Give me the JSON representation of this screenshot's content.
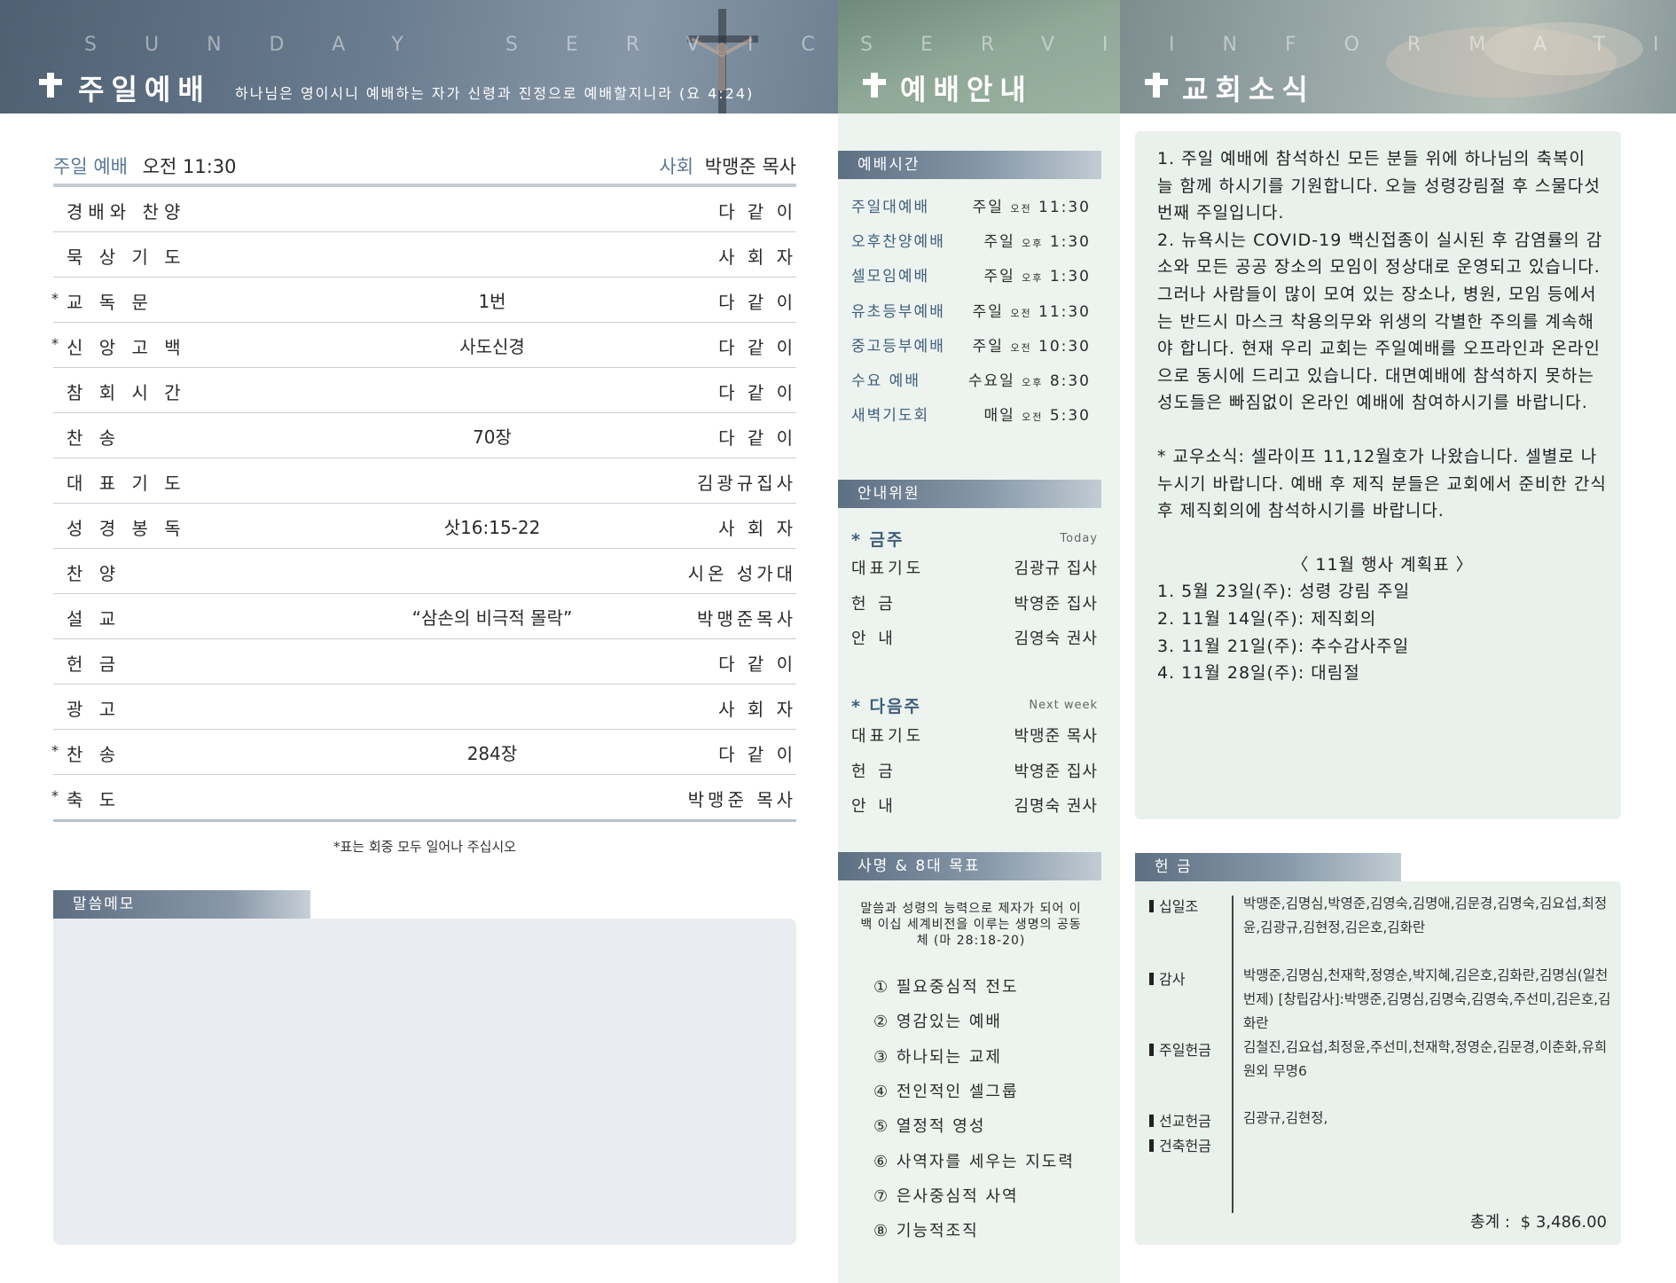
{
  "header": {
    "left_spaced": "SUNDAY SERVICE",
    "left_title": "주일예배",
    "left_verse": "하나님은 영이시니 예배하는 자가 신령과 진정으로 예배할지니라 (요 4:24)",
    "mid_spaced": "SERVICE",
    "mid_title": "예배안내",
    "right_spaced": "INFORMATION",
    "right_title": "교회소식"
  },
  "service": {
    "label": "주일 예배",
    "time": "오전 11:30",
    "leader_label": "사회",
    "leader": "박맹준 목사",
    "rows": [
      {
        "star": "",
        "item": "경배와 찬양",
        "middle": "",
        "who": "다 같 이"
      },
      {
        "star": "",
        "item": "묵 상 기 도",
        "middle": "",
        "who": "사 회 자"
      },
      {
        "star": "*",
        "item": "교   독   문",
        "middle": "1번",
        "who": "다 같 이"
      },
      {
        "star": "*",
        "item": "신 앙 고 백",
        "middle": "사도신경",
        "who": "다 같 이"
      },
      {
        "star": "",
        "item": "참 회 시 간",
        "middle": "",
        "who": "다 같 이"
      },
      {
        "star": "",
        "item": "찬         송",
        "middle": "70장",
        "who": "다 같 이"
      },
      {
        "star": "",
        "item": "대 표 기 도",
        "middle": "",
        "who": "김광규집사"
      },
      {
        "star": "",
        "item": "성 경 봉 독",
        "middle": "삿16:15-22",
        "who": "사 회 자"
      },
      {
        "star": "",
        "item": "찬         양",
        "middle": "",
        "who": "시온 성가대"
      },
      {
        "star": "",
        "item": "설         교",
        "middle": "“삼손의 비극적 몰락”",
        "who": "박맹준목사"
      },
      {
        "star": "",
        "item": "헌         금",
        "middle": "",
        "who": "다  같 이"
      },
      {
        "star": "",
        "item": "광         고",
        "middle": "",
        "who": "사 회 자"
      },
      {
        "star": "*",
        "item": "찬         송",
        "middle": "284장",
        "who": "다 같 이"
      },
      {
        "star": "*",
        "item": "축         도",
        "middle": "",
        "who": "박맹준 목사"
      }
    ],
    "note": "*표는 회중 모두 일어나 주십시오"
  },
  "memo": {
    "title": "말씀메모"
  },
  "times": {
    "title": "예배시간",
    "rows": [
      {
        "name": "주일대예배",
        "day": "주일",
        "ampm": "오전",
        "time": "11:30"
      },
      {
        "name": "오후찬양예배",
        "day": "주일",
        "ampm": "오후",
        "time": "1:30"
      },
      {
        "name": "셀모임예배",
        "day": "주일",
        "ampm": "오후",
        "time": "1:30"
      },
      {
        "name": "유초등부예배",
        "day": "주일",
        "ampm": "오전",
        "time": "11:30"
      },
      {
        "name": "중고등부예배",
        "day": "주일",
        "ampm": "오전",
        "time": "10:30"
      },
      {
        "name": "수요 예배",
        "day": "수요일",
        "ampm": "오후",
        "time": "8:30"
      },
      {
        "name": "새벽기도회",
        "day": "매일",
        "ampm": "오전",
        "time": "5:30"
      }
    ]
  },
  "ushers": {
    "title": "안내위원",
    "this_week": {
      "label": "* 금주",
      "en": "Today",
      "rows": [
        {
          "role": "대표기도",
          "person": "김광규 집사"
        },
        {
          "role": "헌   금",
          "person": "박영준 집사"
        },
        {
          "role": "안   내",
          "person": "김영숙 권사"
        }
      ]
    },
    "next_week": {
      "label": "* 다음주",
      "en": "Next week",
      "rows": [
        {
          "role": "대표기도",
          "person": "박맹준 목사"
        },
        {
          "role": "헌   금",
          "person": "박영준 집사"
        },
        {
          "role": "안   내",
          "person": "김명숙 권사"
        }
      ]
    }
  },
  "mission": {
    "title": "사명 & 8대 목표",
    "statement": "말씀과 성령의 능력으로 제자가 되어 이백 이십 세계비전을 이루는 생명의 공동체 (마 28:18-20)",
    "goals": [
      "① 필요중심적 전도",
      "② 영감있는 예배",
      "③ 하나되는 교제",
      "④ 전인적인 셀그룹",
      "⑤ 열정적 영성",
      "⑥ 사역자를 세우는 지도력",
      "⑦ 은사중심적 사역",
      "⑧ 기능적조직"
    ]
  },
  "news": {
    "paragraphs": [
      "1. 주일 예배에 참석하신 모든 분들 위에 하나님의 축복이 늘 함께 하시기를 기원합니다. 오늘 성령강림절 후 스물다섯 번째 주일입니다.",
      "2. 뉴욕시는 COVID-19 백신접종이 실시된 후 감염률의 감소와 모든 공공 장소의 모임이 정상대로 운영되고 있습니다. 그러나 사람들이 많이 모여 있는 장소나, 병원, 모임 등에서는 반드시 마스크 착용의무와 위생의 각별한 주의를 계속해야 합니다. 현재 우리 교회는 주일예배를 오프라인과 온라인으로 동시에 드리고 있습니다. 대면예배에 참석하지 못하는 성도들은 빠짐없이 온라인 예배에 참여하시기를 바랍니다.",
      "* 교우소식: 셀라이프 11,12월호가 나왔습니다. 셀별로 나누시기 바랍니다. 예배 후 제직 분들은 교회에서 준비한 간식 후 제직회의에 참석하시기를 바랍니다."
    ],
    "schedule_title": "〈 11월 행사 계획표 〉",
    "schedule": [
      "1. 5월 23일(주): 성령 강림 주일",
      "2. 11월 14일(주): 제직회의",
      "3. 11월 21일(주): 추수감사주일",
      "4. 11월 28일(주): 대림절"
    ]
  },
  "offering": {
    "title": "헌 금",
    "categories": [
      {
        "name": "십일조",
        "names": "박맹준,김명심,박영준,김영숙,김명애,김문경,김명숙,김요섭,최정윤,김광규,김현정,김은호,김화란"
      },
      {
        "name": "감사",
        "names": "박맹준,김명심,천재학,정영순,박지혜,김은호,김화란,김명심(일천번제)      [창립감사]:박맹준,김명심,김명숙,김영숙,주선미,김은호,김화란"
      },
      {
        "name": "주일헌금",
        "names": "김철진,김요섭,최정윤,주선미,천재학,정영순,김문경,이춘화,유희원외 무명6"
      },
      {
        "name": "선교헌금",
        "names": "김광규,김현정,"
      },
      {
        "name": "건축헌금",
        "names": ""
      }
    ],
    "total_label": "총계 :",
    "total_value": "$ 3,486.00"
  },
  "colors": {
    "accent": "#3f5e7a",
    "panel_green": "#e9f1ec",
    "memo_gray": "#e9ecf0"
  }
}
